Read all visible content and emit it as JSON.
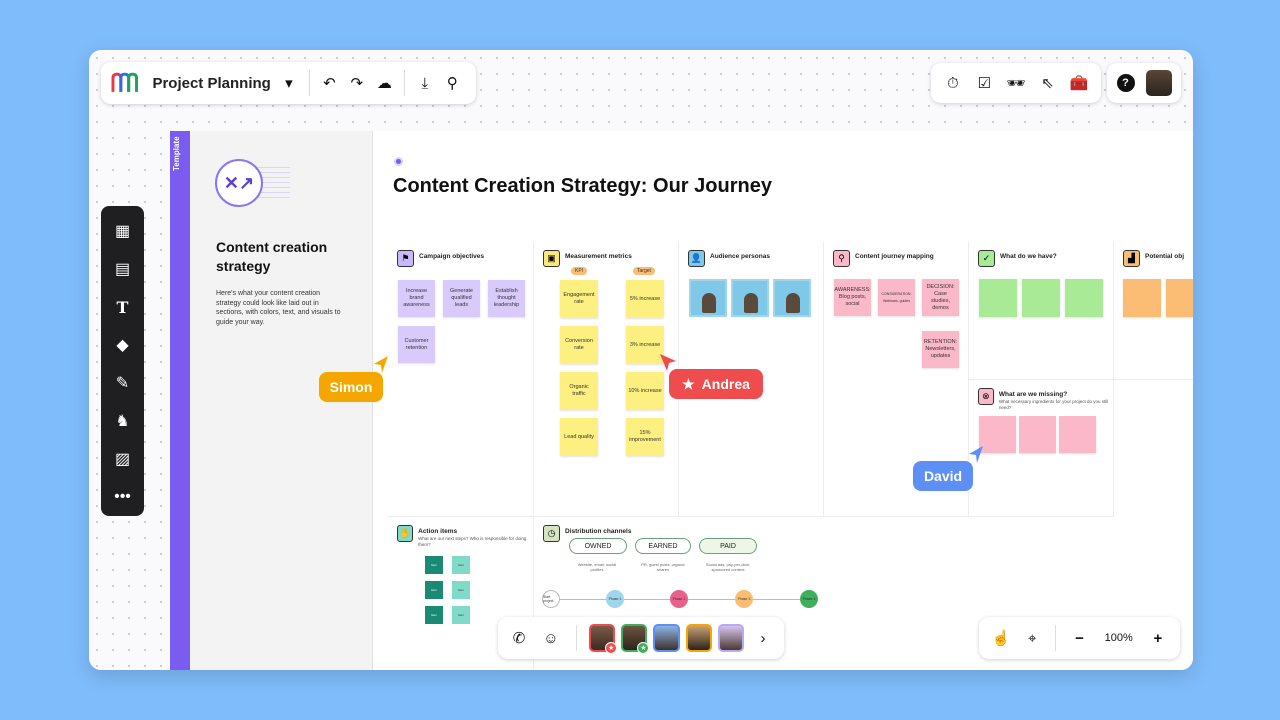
{
  "header": {
    "project_title": "Project Planning",
    "left_icons": [
      "chevron-down-icon",
      "undo-icon",
      "redo-icon",
      "cloud-check-icon",
      "download-icon",
      "search-icon"
    ],
    "right_icons": [
      "timer-icon",
      "checkbox-icon",
      "incognito-icon",
      "cursor-click-icon",
      "toolbox-icon"
    ],
    "help_icon": "question-icon"
  },
  "toolbar": {
    "items": [
      "layout-icon",
      "sticky-note-icon",
      "text-icon",
      "shapes-icon",
      "pen-icon",
      "llama-icon",
      "image-icon",
      "more-icon"
    ]
  },
  "template": {
    "tab_label": "Template",
    "title": "Content creation strategy",
    "description": "Here's what your content creation strategy could look like laid out in sections, with colors, text, and visuals to guide your way."
  },
  "board": {
    "title": "Content Creation Strategy: Our Journey",
    "campaign": {
      "heading": "Campaign objectives",
      "stickies": [
        "Increase brand awareness",
        "Generate qualified leads",
        "Establish thought leadership",
        "Customer retention"
      ]
    },
    "metrics": {
      "heading": "Measurement metrics",
      "kpi_label": "KPI",
      "target_label": "Target",
      "kpis": [
        "Engagement rate",
        "Conversion rate",
        "Organic traffic",
        "Lead quality"
      ],
      "targets": [
        "5% increase",
        "3% increase",
        "10% increase",
        "15% improvement"
      ]
    },
    "audience": {
      "heading": "Audience personas"
    },
    "journey": {
      "heading": "Content journey mapping",
      "stickies": [
        "AWARENESS: Blog posts, social",
        "CONSIDERATION: Webinars, guides",
        "DECISION: Case studies, demos",
        "RETENTION: Newsletters, updates"
      ]
    },
    "have": {
      "heading": "What do we have?"
    },
    "potential": {
      "heading": "Potential obj"
    },
    "missing": {
      "heading": "What are we missing?",
      "sub": "What necessary ingredients for your project do you still need?"
    },
    "actions": {
      "heading": "Action items",
      "sub": "What are our next steps? Who is responsible for doing them?",
      "cells": [
        "Item",
        "Item",
        "Item",
        "Item",
        "Item",
        "Item"
      ]
    },
    "distribution": {
      "heading": "Distribution channels",
      "chips": [
        "OWNED",
        "EARNED",
        "PAID"
      ],
      "notes": [
        "Website, email, social profiles",
        "PR, guest posts, organic shares",
        "Social ads, pay-per-click, sponsored content"
      ],
      "timeline": [
        "Start project",
        "Phase 1",
        "Phase 2",
        "Phase 3",
        "Phase 4"
      ]
    }
  },
  "cursors": {
    "simon": "Simon",
    "andrea": "Andrea",
    "david": "David"
  },
  "bottom": {
    "icons": [
      "phone-icon",
      "emoji-icon",
      "chevron-right-icon"
    ]
  },
  "zoom": {
    "level": "100%",
    "icons": [
      "hand-pointer-icon",
      "map-icon",
      "zoom-out-icon",
      "zoom-in-icon"
    ]
  },
  "colors": {
    "accent": "#7b5cf0",
    "simon": "#f5a700",
    "andrea": "#ef4d4d",
    "david": "#5d8ff5"
  }
}
